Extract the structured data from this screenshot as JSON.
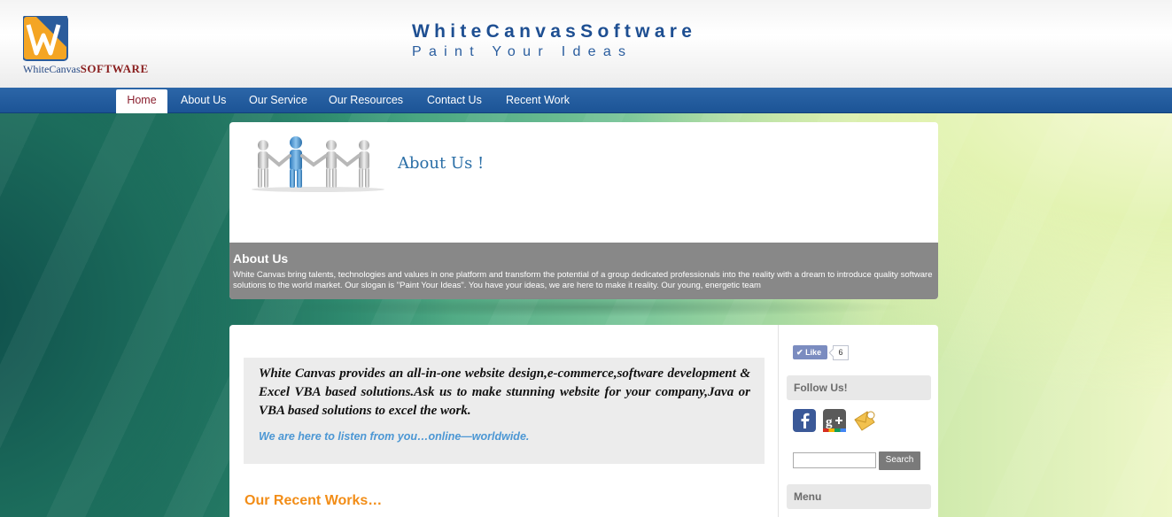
{
  "header": {
    "logo_text_regular": "WhiteCanvas",
    "logo_text_bold": "SOFTWARE",
    "site_title": "WhiteCanvasSoftware",
    "tagline": "Paint Your Ideas"
  },
  "nav": {
    "items": [
      "Home",
      "About Us",
      "Our Service",
      "Our Resources",
      "Contact Us",
      "Recent Work"
    ],
    "active": "Home"
  },
  "banner": {
    "heading": "About Us !",
    "band_title": "About Us",
    "band_text": "White Canvas  bring talents, technologies and values in one platform and transform the potential of a group dedicated professionals into the reality with a dream to introduce quality software solutions to the world market. Our slogan is \"Paint Your Ideas\". You have your ideas, we are here to make it reality. Our young, energetic team"
  },
  "main": {
    "promo_text": "White Canvas provides an all-in-one website design,e-commerce,software development & Excel VBA based solutions.Ask us to make stunning website for your company,Java or VBA based solutions to excel the work.",
    "promo_sub": "We are here to listen from you…online—worldwide.",
    "recent_works_heading": "Our Recent Works…"
  },
  "sidebar": {
    "like_label": "Like",
    "like_count": "6",
    "follow_heading": "Follow Us!",
    "social_icons": [
      "facebook-icon",
      "google-plus-icon",
      "email-icon"
    ],
    "search_button": "Search",
    "menu_heading": "Menu"
  },
  "colors": {
    "nav_bg": "#1c5496",
    "title_blue": "#1e4f92",
    "accent_orange": "#f28d17",
    "link_blue": "#4c97d4",
    "active_nav_text": "#8a1f2e"
  }
}
